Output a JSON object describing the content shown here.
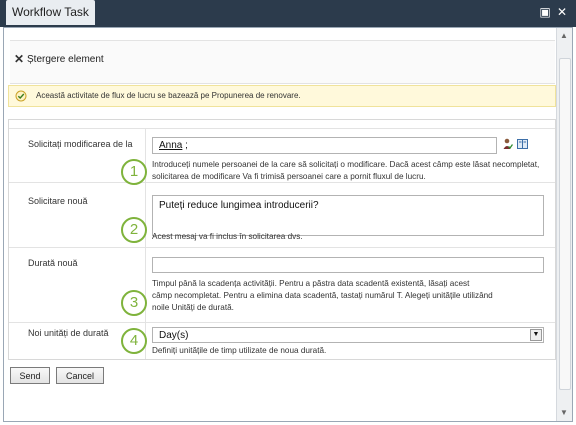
{
  "window": {
    "title": "Workflow Task"
  },
  "ribbon": {
    "delete_label": "Ștergere element"
  },
  "info": {
    "text": "Această activitate de flux de lucru se bazează pe Propunerea de renovare."
  },
  "form": {
    "request_from": {
      "label": "Solicitați modificarea de la",
      "value_name": "Anna",
      "value_sep": " ;",
      "number": "1",
      "desc": [
        "Introduceți numele persoanei de la care să solicitați o modificare. Dacă acest câmp este lăsat necompletat,",
        "solicitarea de modificare Va fi trimisă persoanei care a pornit fluxul de lucru."
      ]
    },
    "new_request": {
      "label": "Solicitare nouă",
      "value": "Puteți reduce lungimea introducerii?",
      "number": "2",
      "desc": [
        "Acest mesaj va fi inclus în solicitarea dvs."
      ]
    },
    "new_duration": {
      "label": "Durată nouă",
      "value": "",
      "number": "3",
      "desc": [
        "Timpul până la scadența activității. Pentru a păstra data scadentă existentă, lăsați acest",
        "câmp necompletat. Pentru a elimina data scadentă, tastați numărul T. Alegeți unitățile utilizând",
        "noile Unități de durată."
      ]
    },
    "duration_units": {
      "label": "Noi unități de durată",
      "value": "Day(s)",
      "number": "4",
      "desc": [
        "Definiți unitățile de timp utilizate de noua durată."
      ]
    }
  },
  "buttons": {
    "send": "Send",
    "cancel": "Cancel"
  },
  "icons": {
    "maximize": "maximize-icon",
    "close": "close-icon",
    "delete": "x-icon",
    "info": "checkmark-icon",
    "people": "person-check-icon",
    "book": "address-book-icon"
  },
  "colors": {
    "titlebar": "#2c3b4c",
    "step_number": "#7fb33c",
    "info_bg": "#fff9db"
  }
}
